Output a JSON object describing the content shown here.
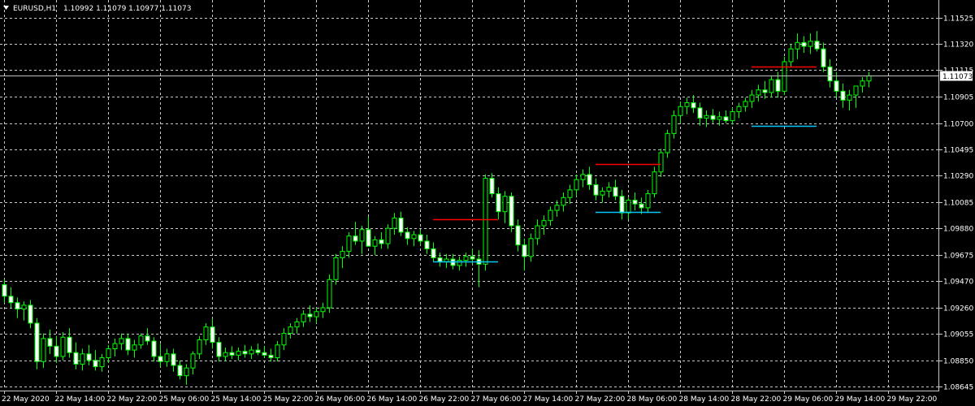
{
  "header": {
    "symbol": "EURUSD,H1",
    "ohlc": "1.10992 1.11079 1.10977 1.11073",
    "menu_icon": "triangle-down-icon"
  },
  "colors": {
    "background": "#000000",
    "grid": "#c8c8c8",
    "candle": "#00ff00",
    "resistance": "#ff0000",
    "support": "#00c8ff",
    "bid_line": "#c0c0c0",
    "bid_tag_bg": "#ffffff"
  },
  "chart_data": {
    "type": "candlestick",
    "timeframe": "H1",
    "symbol": "EURUSD",
    "ylim": [
      1.0862,
      1.1163
    ],
    "y_ticks": [
      "1.11525",
      "1.11320",
      "1.11115",
      "1.10905",
      "1.10700",
      "1.10495",
      "1.10290",
      "1.10085",
      "1.09880",
      "1.09675",
      "1.09470",
      "1.09260",
      "1.09055",
      "1.08850",
      "1.08645"
    ],
    "x_ticks": [
      "22 May 2020",
      "22 May 14:00",
      "22 May 22:00",
      "25 May 06:00",
      "25 May 14:00",
      "25 May 22:00",
      "26 May 06:00",
      "26 May 14:00",
      "26 May 22:00",
      "27 May 06:00",
      "27 May 14:00",
      "27 May 22:00",
      "28 May 06:00",
      "28 May 14:00",
      "28 May 22:00",
      "29 May 06:00",
      "29 May 14:00",
      "29 May 22:00"
    ],
    "current_price": "1.11073",
    "ohlc": [
      [
        1.0944,
        1.0948,
        1.093,
        1.0935
      ],
      [
        1.0935,
        1.0942,
        1.0926,
        1.093
      ],
      [
        1.093,
        1.0934,
        1.0918,
        1.0925
      ],
      [
        1.0925,
        1.0931,
        1.0916,
        1.0928
      ],
      [
        1.0928,
        1.0932,
        1.091,
        1.0914
      ],
      [
        1.0914,
        1.0918,
        1.0878,
        1.0884
      ],
      [
        1.0884,
        1.0906,
        1.0879,
        1.0902
      ],
      [
        1.0902,
        1.0909,
        1.089,
        1.0896
      ],
      [
        1.0896,
        1.0904,
        1.0883,
        1.0888
      ],
      [
        1.0888,
        1.0907,
        1.0885,
        1.0903
      ],
      [
        1.0903,
        1.091,
        1.0887,
        1.0891
      ],
      [
        1.0891,
        1.0899,
        1.0878,
        1.0882
      ],
      [
        1.0882,
        1.0894,
        1.0877,
        1.089
      ],
      [
        1.089,
        1.0897,
        1.0881,
        1.0885
      ],
      [
        1.0885,
        1.0893,
        1.0877,
        1.088
      ],
      [
        1.088,
        1.089,
        1.0876,
        1.0887
      ],
      [
        1.0887,
        1.0897,
        1.0883,
        1.0894
      ],
      [
        1.0894,
        1.0902,
        1.0888,
        1.0898
      ],
      [
        1.0898,
        1.0906,
        1.0893,
        1.0902
      ],
      [
        1.0902,
        1.0906,
        1.0889,
        1.0893
      ],
      [
        1.0893,
        1.0901,
        1.0887,
        1.0897
      ],
      [
        1.0897,
        1.0906,
        1.0894,
        1.0904
      ],
      [
        1.0904,
        1.091,
        1.0897,
        1.09
      ],
      [
        1.09,
        1.0903,
        1.0884,
        1.0888
      ],
      [
        1.0888,
        1.0898,
        1.088,
        1.0884
      ],
      [
        1.0884,
        1.0894,
        1.088,
        1.089
      ],
      [
        1.089,
        1.0894,
        1.0876,
        1.0881
      ],
      [
        1.0881,
        1.0885,
        1.087,
        1.0873
      ],
      [
        1.0873,
        1.0882,
        1.0866,
        1.0879
      ],
      [
        1.0879,
        1.0892,
        1.0874,
        1.089
      ],
      [
        1.089,
        1.0904,
        1.0886,
        1.0901
      ],
      [
        1.0901,
        1.0914,
        1.0897,
        1.0911
      ],
      [
        1.0911,
        1.0917,
        1.0894,
        1.0899
      ],
      [
        1.0899,
        1.0903,
        1.0884,
        1.0888
      ],
      [
        1.0888,
        1.0895,
        1.0884,
        1.0891
      ],
      [
        1.0891,
        1.0896,
        1.0886,
        1.0889
      ],
      [
        1.0889,
        1.0895,
        1.0885,
        1.0892
      ],
      [
        1.0892,
        1.0897,
        1.0887,
        1.089
      ],
      [
        1.089,
        1.0896,
        1.0886,
        1.0893
      ],
      [
        1.0893,
        1.0898,
        1.0889,
        1.0891
      ],
      [
        1.0891,
        1.0896,
        1.0887,
        1.0889
      ],
      [
        1.0889,
        1.0894,
        1.0884,
        1.0887
      ],
      [
        1.0887,
        1.09,
        1.0884,
        1.0897
      ],
      [
        1.0897,
        1.091,
        1.0893,
        1.0906
      ],
      [
        1.0906,
        1.0914,
        1.0902,
        1.0911
      ],
      [
        1.0911,
        1.0918,
        1.0906,
        1.0915
      ],
      [
        1.0915,
        1.0924,
        1.0911,
        1.0921
      ],
      [
        1.0921,
        1.0928,
        1.0915,
        1.0919
      ],
      [
        1.0919,
        1.0926,
        1.0914,
        1.0923
      ],
      [
        1.0923,
        1.093,
        1.0918,
        1.0926
      ],
      [
        1.0926,
        1.0952,
        1.0922,
        1.0948
      ],
      [
        1.0948,
        1.0968,
        1.0944,
        1.0965
      ],
      [
        1.0965,
        1.0974,
        1.0957,
        1.097
      ],
      [
        1.097,
        1.0985,
        1.0965,
        1.0982
      ],
      [
        1.0982,
        1.0993,
        1.0975,
        1.0978
      ],
      [
        1.0978,
        1.099,
        1.0968,
        1.0987
      ],
      [
        1.0987,
        1.0997,
        1.0981,
        1.0974
      ],
      [
        1.0974,
        1.0982,
        1.0967,
        1.0979
      ],
      [
        1.0979,
        1.0985,
        1.0972,
        1.0976
      ],
      [
        1.0976,
        1.0991,
        1.0972,
        1.0988
      ],
      [
        1.0988,
        1.1,
        1.0983,
        1.0996
      ],
      [
        1.0996,
        1.1001,
        1.0982,
        1.0985
      ],
      [
        1.0985,
        1.0989,
        1.0975,
        1.098
      ],
      [
        1.098,
        1.0986,
        1.0974,
        1.0983
      ],
      [
        1.0983,
        1.0987,
        1.0975,
        1.0978
      ],
      [
        1.0978,
        1.0983,
        1.0968,
        1.0972
      ],
      [
        1.0972,
        1.0977,
        1.0962,
        1.0965
      ],
      [
        1.0965,
        1.0969,
        1.0958,
        1.0962
      ],
      [
        1.0962,
        1.0968,
        1.0957,
        1.0964
      ],
      [
        1.0964,
        1.0968,
        1.0956,
        1.0959
      ],
      [
        1.0959,
        1.0966,
        1.0955,
        1.0963
      ],
      [
        1.0963,
        1.0969,
        1.0958,
        1.0966
      ],
      [
        1.0966,
        1.0972,
        1.096,
        1.0964
      ],
      [
        1.0964,
        1.0971,
        1.0942,
        1.096
      ],
      [
        1.096,
        1.103,
        1.0955,
        1.1027
      ],
      [
        1.1027,
        1.1031,
        1.1012,
        1.1015
      ],
      [
        1.1015,
        1.102,
        1.0995,
        1.1001
      ],
      [
        1.1001,
        1.1017,
        1.0992,
        1.1013
      ],
      [
        1.1013,
        1.1016,
        1.0985,
        1.099
      ],
      [
        1.099,
        1.0995,
        1.097,
        1.0975
      ],
      [
        1.0975,
        1.098,
        1.0955,
        1.0966
      ],
      [
        1.0966,
        1.0984,
        1.0962,
        1.098
      ],
      [
        1.098,
        1.0995,
        1.0975,
        1.099
      ],
      [
        1.099,
        1.0998,
        1.0983,
        1.0994
      ],
      [
        1.0994,
        1.1005,
        1.099,
        1.1002
      ],
      [
        1.1002,
        1.101,
        1.0997,
        1.1006
      ],
      [
        1.1006,
        1.1016,
        1.1001,
        1.1012
      ],
      [
        1.1012,
        1.1022,
        1.1007,
        1.1018
      ],
      [
        1.1018,
        1.103,
        1.1013,
        1.1026
      ],
      [
        1.1026,
        1.1034,
        1.102,
        1.103
      ],
      [
        1.103,
        1.1036,
        1.1018,
        1.1022
      ],
      [
        1.1022,
        1.1027,
        1.101,
        1.1014
      ],
      [
        1.1014,
        1.102,
        1.1008,
        1.1017
      ],
      [
        1.1017,
        1.1024,
        1.1012,
        1.102
      ],
      [
        1.102,
        1.1026,
        1.101,
        1.1013
      ],
      [
        1.1013,
        1.1018,
        1.0995,
        1.1
      ],
      [
        1.1,
        1.1012,
        1.0995,
        1.101
      ],
      [
        1.101,
        1.1016,
        1.1002,
        1.1007
      ],
      [
        1.1007,
        1.1012,
        1.0999,
        1.1004
      ],
      [
        1.1004,
        1.1018,
        1.1,
        1.1015
      ],
      [
        1.1015,
        1.1036,
        1.1012,
        1.1032
      ],
      [
        1.1032,
        1.105,
        1.1028,
        1.1047
      ],
      [
        1.1047,
        1.1065,
        1.1043,
        1.1062
      ],
      [
        1.1062,
        1.108,
        1.1058,
        1.1076
      ],
      [
        1.1076,
        1.1087,
        1.107,
        1.1083
      ],
      [
        1.1083,
        1.109,
        1.1077,
        1.1086
      ],
      [
        1.1086,
        1.1092,
        1.1078,
        1.1082
      ],
      [
        1.1082,
        1.1086,
        1.1068,
        1.1074
      ],
      [
        1.1074,
        1.108,
        1.1067,
        1.1076
      ],
      [
        1.1076,
        1.1081,
        1.107,
        1.1073
      ],
      [
        1.1073,
        1.1079,
        1.1068,
        1.1075
      ],
      [
        1.1075,
        1.108,
        1.107,
        1.1072
      ],
      [
        1.1072,
        1.1082,
        1.1069,
        1.1079
      ],
      [
        1.1079,
        1.1086,
        1.1074,
        1.1083
      ],
      [
        1.1083,
        1.109,
        1.1079,
        1.1087
      ],
      [
        1.1087,
        1.1096,
        1.1082,
        1.1092
      ],
      [
        1.1092,
        1.11,
        1.1087,
        1.1096
      ],
      [
        1.1096,
        1.1103,
        1.1089,
        1.1094
      ],
      [
        1.1094,
        1.1107,
        1.109,
        1.1104
      ],
      [
        1.1104,
        1.111,
        1.109,
        1.1095
      ],
      [
        1.1095,
        1.1122,
        1.1092,
        1.1118
      ],
      [
        1.1118,
        1.1132,
        1.1114,
        1.1128
      ],
      [
        1.1128,
        1.114,
        1.112,
        1.1133
      ],
      [
        1.1133,
        1.1138,
        1.1125,
        1.113
      ],
      [
        1.113,
        1.114,
        1.1124,
        1.1134
      ],
      [
        1.1134,
        1.1142,
        1.1126,
        1.1128
      ],
      [
        1.1128,
        1.1133,
        1.111,
        1.1114
      ],
      [
        1.1114,
        1.112,
        1.1098,
        1.1103
      ],
      [
        1.1103,
        1.111,
        1.109,
        1.1095
      ],
      [
        1.1095,
        1.1101,
        1.1082,
        1.1088
      ],
      [
        1.1088,
        1.1096,
        1.108,
        1.1092
      ],
      [
        1.1092,
        1.1098,
        1.1082,
        1.1099
      ],
      [
        1.1099,
        1.1106,
        1.1094,
        1.1103
      ],
      [
        1.1103,
        1.111,
        1.1098,
        1.1107
      ]
    ],
    "levels": [
      {
        "kind": "resistance",
        "price": 1.0995,
        "from_bar": 66,
        "to_bar": 76
      },
      {
        "kind": "support",
        "price": 1.0962,
        "from_bar": 66,
        "to_bar": 76
      },
      {
        "kind": "resistance",
        "price": 1.1038,
        "from_bar": 91,
        "to_bar": 101
      },
      {
        "kind": "support",
        "price": 1.1001,
        "from_bar": 91,
        "to_bar": 101
      },
      {
        "kind": "resistance",
        "price": 1.1114,
        "from_bar": 115,
        "to_bar": 125
      },
      {
        "kind": "support",
        "price": 1.1068,
        "from_bar": 115,
        "to_bar": 125
      }
    ]
  }
}
